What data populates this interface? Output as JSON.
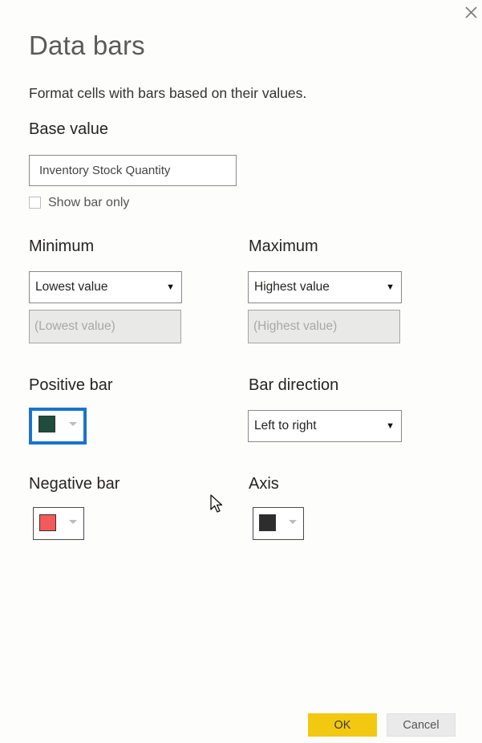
{
  "dialog": {
    "title": "Data bars",
    "description": "Format cells with bars based on their values.",
    "close_icon": "close-icon"
  },
  "base_value": {
    "label": "Base value",
    "field_value": "Inventory Stock Quantity",
    "show_bar_only": {
      "label": "Show bar only",
      "checked": false
    }
  },
  "minimum": {
    "label": "Minimum",
    "selected": "Lowest value",
    "value_placeholder": "(Lowest value)"
  },
  "maximum": {
    "label": "Maximum",
    "selected": "Highest value",
    "value_placeholder": "(Highest value)"
  },
  "positive_bar": {
    "label": "Positive bar",
    "color": "#1e4d3e"
  },
  "bar_direction": {
    "label": "Bar direction",
    "selected": "Left to right"
  },
  "negative_bar": {
    "label": "Negative bar",
    "color": "#f45a5a"
  },
  "axis": {
    "label": "Axis",
    "color": "#2d2d2d"
  },
  "buttons": {
    "ok": "OK",
    "cancel": "Cancel"
  },
  "colors": {
    "accent_ok": "#f2c811",
    "focus_outline": "#1a73d1"
  }
}
